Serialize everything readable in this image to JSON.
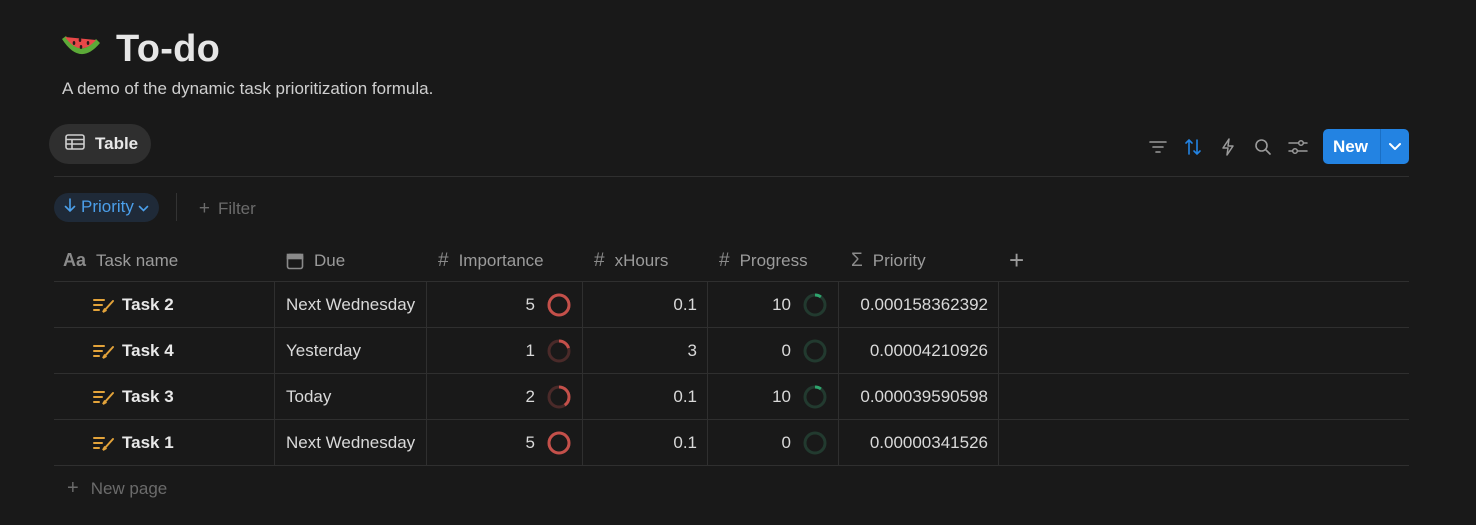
{
  "page": {
    "emoji": "watermelon-icon",
    "title": "To-do",
    "subtitle": "A demo of the dynamic task prioritization formula."
  },
  "view": {
    "tab_label": "Table"
  },
  "toolbar": {
    "icons": [
      "filter-icon",
      "sort-icon",
      "lightning-icon",
      "search-icon",
      "settings-icon"
    ],
    "new_label": "New"
  },
  "filters": {
    "sort_label": "Priority",
    "add_filter_label": "Filter"
  },
  "table": {
    "columns": [
      {
        "icon": "text-icon",
        "label": "Task name"
      },
      {
        "icon": "calendar-icon",
        "label": "Due"
      },
      {
        "icon": "number-icon",
        "label": "Importance"
      },
      {
        "icon": "number-icon",
        "label": "xHours"
      },
      {
        "icon": "number-icon",
        "label": "Progress"
      },
      {
        "icon": "sigma-icon",
        "label": "Priority"
      }
    ],
    "rows": [
      {
        "name": "Task 2",
        "due": "Next Wednesday",
        "importance": "5",
        "importance_fill": 1.0,
        "xhours": "0.1",
        "progress": "10",
        "progress_fill": 0.1,
        "priority": "0.000158362392"
      },
      {
        "name": "Task 4",
        "due": "Yesterday",
        "importance": "1",
        "importance_fill": 0.2,
        "xhours": "3",
        "progress": "0",
        "progress_fill": 0.0,
        "priority": "0.00004210926"
      },
      {
        "name": "Task 3",
        "due": "Today",
        "importance": "2",
        "importance_fill": 0.4,
        "xhours": "0.1",
        "progress": "10",
        "progress_fill": 0.1,
        "priority": "0.000039590598"
      },
      {
        "name": "Task 1",
        "due": "Next Wednesday",
        "importance": "5",
        "importance_fill": 1.0,
        "xhours": "0.1",
        "progress": "0",
        "progress_fill": 0.0,
        "priority": "0.00000341526"
      }
    ],
    "new_page_label": "New page"
  },
  "colors": {
    "accent": "#2383e2",
    "sort_text": "#4b9fea",
    "task_icon": "#e3a33a",
    "importance_ring": "#c4504a",
    "importance_track": "#4a2a29",
    "progress_ring": "#2ea46d",
    "progress_track": "#223a2f"
  }
}
